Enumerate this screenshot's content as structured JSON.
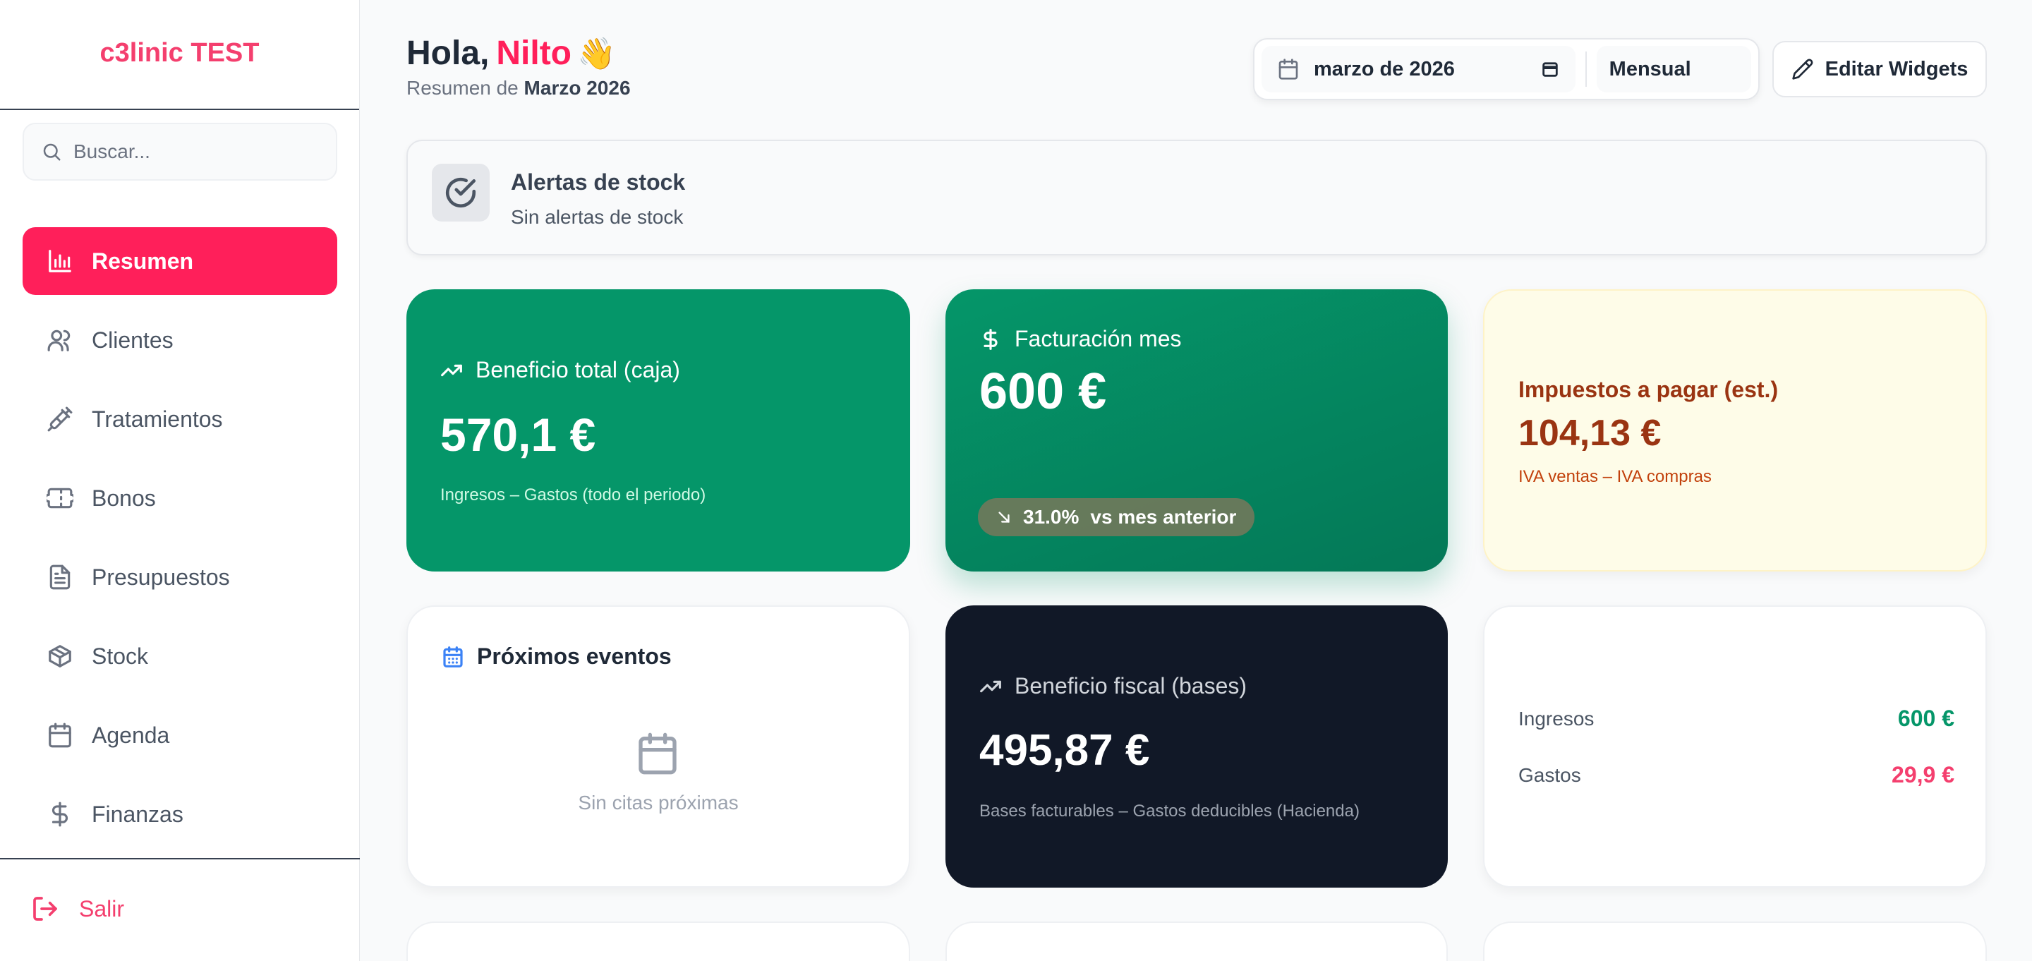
{
  "app": {
    "brand": "c3linic TEST"
  },
  "search": {
    "placeholder": "Buscar..."
  },
  "sidebar": {
    "items": [
      {
        "label": "Resumen",
        "icon": "bar-chart-icon",
        "active": true
      },
      {
        "label": "Clientes",
        "icon": "users-icon"
      },
      {
        "label": "Tratamientos",
        "icon": "syringe-icon"
      },
      {
        "label": "Bonos",
        "icon": "ticket-icon"
      },
      {
        "label": "Presupuestos",
        "icon": "file-text-icon"
      },
      {
        "label": "Stock",
        "icon": "package-icon"
      },
      {
        "label": "Agenda",
        "icon": "calendar-icon"
      },
      {
        "label": "Finanzas",
        "icon": "dollar-icon"
      }
    ],
    "logout": "Salir"
  },
  "header": {
    "greeting": "Hola,",
    "name": "Nilto",
    "wave": "👋",
    "summary_prefix": "Resumen de",
    "summary_period": "Marzo 2026",
    "date_value": "marzo de 2026",
    "period_mode": "Mensual",
    "edit_label": "Editar Widgets"
  },
  "stock_alert": {
    "title": "Alertas de stock",
    "message": "Sin alertas de stock"
  },
  "cards": {
    "profit_cash": {
      "title": "Beneficio total (caja)",
      "value": "570,1 €",
      "note": "Ingresos – Gastos (todo el periodo)"
    },
    "billing": {
      "title": "Facturación mes",
      "value": "600 €",
      "change": "31.0%",
      "change_label": "vs mes anterior"
    },
    "taxes": {
      "title": "Impuestos a pagar (est.)",
      "value": "104,13 €",
      "note": "IVA ventas – IVA compras"
    },
    "events": {
      "title": "Próximos eventos",
      "empty": "Sin citas próximas"
    },
    "profit_fiscal": {
      "title": "Beneficio fiscal (bases)",
      "value": "495,87 €",
      "note": "Bases facturables – Gastos deducibles (Hacienda)"
    },
    "summary": {
      "income_label": "Ingresos",
      "income_value": "600 €",
      "expense_label": "Gastos",
      "expense_value": "29,9 €"
    }
  },
  "colors": {
    "accent": "#ff1f5a",
    "green": "#059669",
    "dark": "#111827",
    "income": "#059669",
    "expense": "#f43f6e",
    "tax": "#9a3412"
  }
}
